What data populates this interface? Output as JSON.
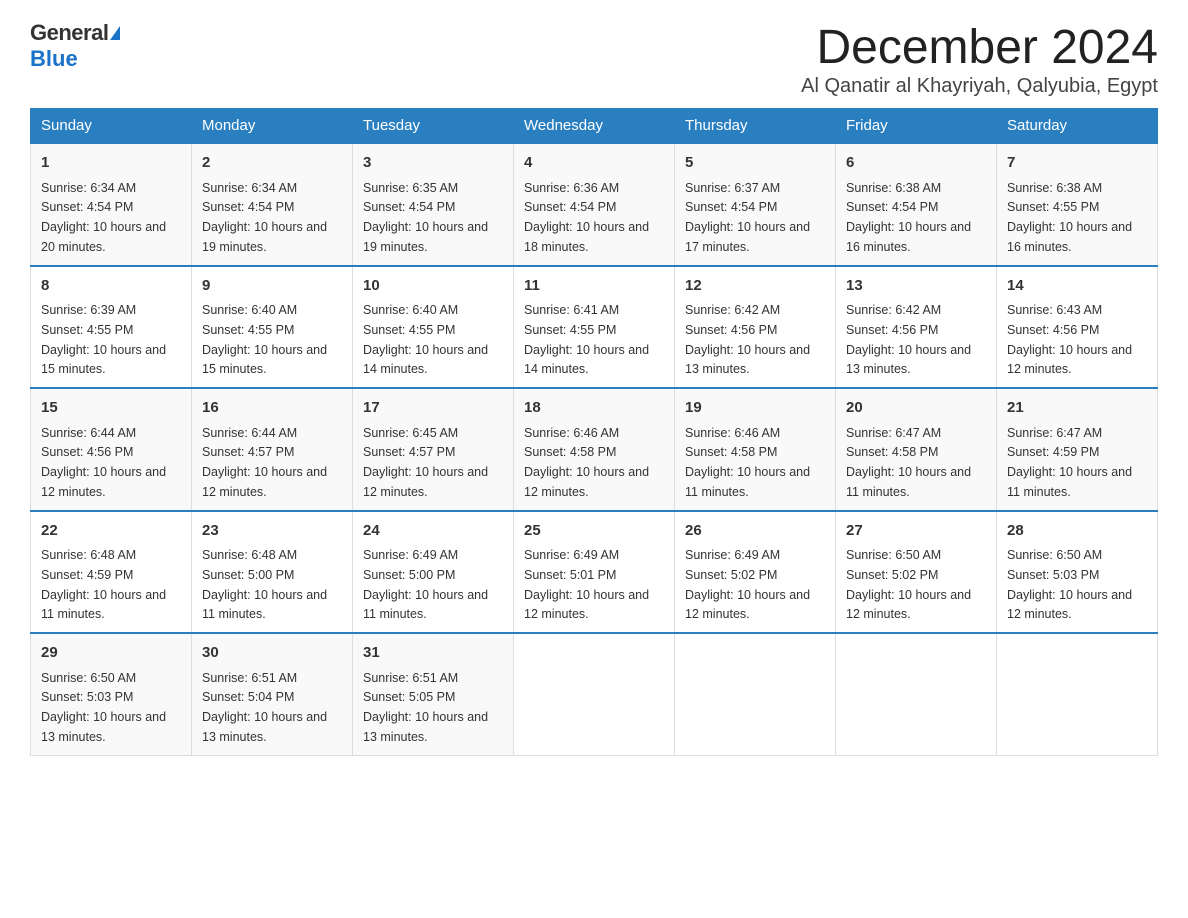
{
  "header": {
    "logo_general": "General",
    "logo_blue": "Blue",
    "main_title": "December 2024",
    "subtitle": "Al Qanatir al Khayriyah, Qalyubia, Egypt"
  },
  "days_of_week": [
    "Sunday",
    "Monday",
    "Tuesday",
    "Wednesday",
    "Thursday",
    "Friday",
    "Saturday"
  ],
  "weeks": [
    [
      {
        "day": "1",
        "sunrise": "6:34 AM",
        "sunset": "4:54 PM",
        "daylight": "10 hours and 20 minutes."
      },
      {
        "day": "2",
        "sunrise": "6:34 AM",
        "sunset": "4:54 PM",
        "daylight": "10 hours and 19 minutes."
      },
      {
        "day": "3",
        "sunrise": "6:35 AM",
        "sunset": "4:54 PM",
        "daylight": "10 hours and 19 minutes."
      },
      {
        "day": "4",
        "sunrise": "6:36 AM",
        "sunset": "4:54 PM",
        "daylight": "10 hours and 18 minutes."
      },
      {
        "day": "5",
        "sunrise": "6:37 AM",
        "sunset": "4:54 PM",
        "daylight": "10 hours and 17 minutes."
      },
      {
        "day": "6",
        "sunrise": "6:38 AM",
        "sunset": "4:54 PM",
        "daylight": "10 hours and 16 minutes."
      },
      {
        "day": "7",
        "sunrise": "6:38 AM",
        "sunset": "4:55 PM",
        "daylight": "10 hours and 16 minutes."
      }
    ],
    [
      {
        "day": "8",
        "sunrise": "6:39 AM",
        "sunset": "4:55 PM",
        "daylight": "10 hours and 15 minutes."
      },
      {
        "day": "9",
        "sunrise": "6:40 AM",
        "sunset": "4:55 PM",
        "daylight": "10 hours and 15 minutes."
      },
      {
        "day": "10",
        "sunrise": "6:40 AM",
        "sunset": "4:55 PM",
        "daylight": "10 hours and 14 minutes."
      },
      {
        "day": "11",
        "sunrise": "6:41 AM",
        "sunset": "4:55 PM",
        "daylight": "10 hours and 14 minutes."
      },
      {
        "day": "12",
        "sunrise": "6:42 AM",
        "sunset": "4:56 PM",
        "daylight": "10 hours and 13 minutes."
      },
      {
        "day": "13",
        "sunrise": "6:42 AM",
        "sunset": "4:56 PM",
        "daylight": "10 hours and 13 minutes."
      },
      {
        "day": "14",
        "sunrise": "6:43 AM",
        "sunset": "4:56 PM",
        "daylight": "10 hours and 12 minutes."
      }
    ],
    [
      {
        "day": "15",
        "sunrise": "6:44 AM",
        "sunset": "4:56 PM",
        "daylight": "10 hours and 12 minutes."
      },
      {
        "day": "16",
        "sunrise": "6:44 AM",
        "sunset": "4:57 PM",
        "daylight": "10 hours and 12 minutes."
      },
      {
        "day": "17",
        "sunrise": "6:45 AM",
        "sunset": "4:57 PM",
        "daylight": "10 hours and 12 minutes."
      },
      {
        "day": "18",
        "sunrise": "6:46 AM",
        "sunset": "4:58 PM",
        "daylight": "10 hours and 12 minutes."
      },
      {
        "day": "19",
        "sunrise": "6:46 AM",
        "sunset": "4:58 PM",
        "daylight": "10 hours and 11 minutes."
      },
      {
        "day": "20",
        "sunrise": "6:47 AM",
        "sunset": "4:58 PM",
        "daylight": "10 hours and 11 minutes."
      },
      {
        "day": "21",
        "sunrise": "6:47 AM",
        "sunset": "4:59 PM",
        "daylight": "10 hours and 11 minutes."
      }
    ],
    [
      {
        "day": "22",
        "sunrise": "6:48 AM",
        "sunset": "4:59 PM",
        "daylight": "10 hours and 11 minutes."
      },
      {
        "day": "23",
        "sunrise": "6:48 AM",
        "sunset": "5:00 PM",
        "daylight": "10 hours and 11 minutes."
      },
      {
        "day": "24",
        "sunrise": "6:49 AM",
        "sunset": "5:00 PM",
        "daylight": "10 hours and 11 minutes."
      },
      {
        "day": "25",
        "sunrise": "6:49 AM",
        "sunset": "5:01 PM",
        "daylight": "10 hours and 12 minutes."
      },
      {
        "day": "26",
        "sunrise": "6:49 AM",
        "sunset": "5:02 PM",
        "daylight": "10 hours and 12 minutes."
      },
      {
        "day": "27",
        "sunrise": "6:50 AM",
        "sunset": "5:02 PM",
        "daylight": "10 hours and 12 minutes."
      },
      {
        "day": "28",
        "sunrise": "6:50 AM",
        "sunset": "5:03 PM",
        "daylight": "10 hours and 12 minutes."
      }
    ],
    [
      {
        "day": "29",
        "sunrise": "6:50 AM",
        "sunset": "5:03 PM",
        "daylight": "10 hours and 13 minutes."
      },
      {
        "day": "30",
        "sunrise": "6:51 AM",
        "sunset": "5:04 PM",
        "daylight": "10 hours and 13 minutes."
      },
      {
        "day": "31",
        "sunrise": "6:51 AM",
        "sunset": "5:05 PM",
        "daylight": "10 hours and 13 minutes."
      },
      null,
      null,
      null,
      null
    ]
  ]
}
